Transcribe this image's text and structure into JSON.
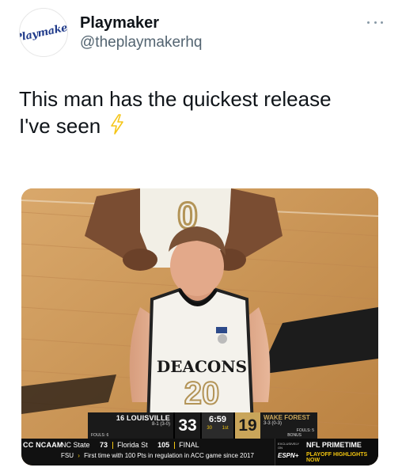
{
  "header": {
    "avatar_logo_text": "Playmaker",
    "display_name": "Playmaker",
    "handle": "@theplaymakerhq",
    "more_icon": "ellipsis-icon"
  },
  "tweet": {
    "text_line1": "This man has the quickest release",
    "text_line2": "I've seen",
    "emoji_icon": "lightning-bolt-icon"
  },
  "media": {
    "jersey_back_number": "0",
    "jersey_text": "DEACONS",
    "jersey_number": "20",
    "scorebug": {
      "away": {
        "rank": "16",
        "name": "LOUISVILLE",
        "record": "8-1 (3-0)",
        "fouls": "FOULS: 6",
        "score": "33"
      },
      "clock": {
        "time": "6:59",
        "shot_clock": "30",
        "period": "1st"
      },
      "home": {
        "name": "WAKE FOREST",
        "record": "3-3 (0-3)",
        "bonus": "BONUS",
        "fouls": "FOULS: 5",
        "score": "19"
      }
    },
    "ticker": {
      "label": "CC NCAAM",
      "team1": "NC State",
      "score1": "73",
      "team2": "Florida St",
      "score2": "105",
      "status": "FINAL",
      "row2_team": "FSU",
      "row2_text": "First time with 100 Pts in regulation in ACC game since 2017",
      "ad_exclusive": "EXCLUSIVELY ON",
      "ad_network": "ESPN+",
      "ad_title": "NFL PRIMETIME",
      "ad_subtitle": "PLAYOFF HIGHLIGHTS  NOW"
    }
  },
  "colors": {
    "accent_gold": "#c9a55a",
    "bolt_yellow": "#f5c518",
    "text_primary": "#0f1419",
    "text_secondary": "#536471"
  }
}
